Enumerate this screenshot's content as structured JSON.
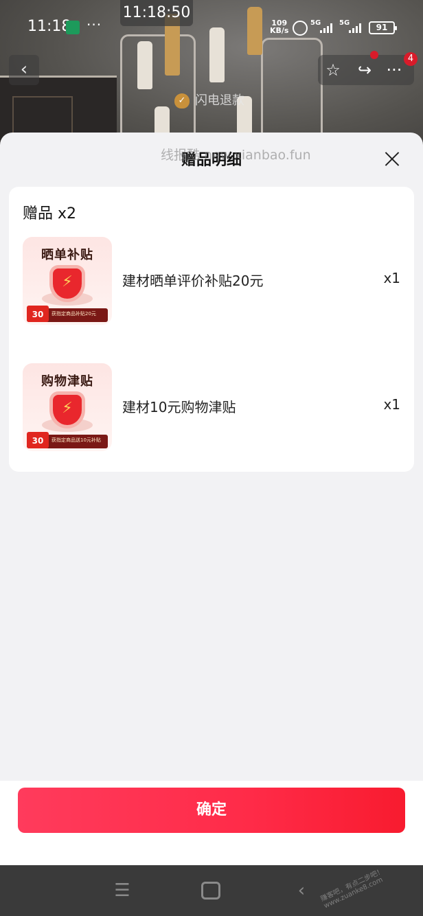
{
  "status_bar": {
    "time": "11:18",
    "screen_clock": "11:18:50",
    "more": "···",
    "net_speed_value": "109",
    "net_speed_unit": "KB/s",
    "signal_1": "5G",
    "signal_2": "5G",
    "battery": "91"
  },
  "nav": {
    "back_icon": "‹",
    "star_icon": "☆",
    "share_icon": "↪",
    "more_icon": "···",
    "more_badge": "4"
  },
  "banner": {
    "refund_label": "闪电退款"
  },
  "sheet": {
    "title": "赠品明细",
    "watermark": "线报酷 new.xianbao.fun",
    "gift_header": "赠品 x2",
    "gifts": [
      {
        "thumb_title": "晒单补贴",
        "thumb_tag": "30",
        "thumb_strip": "获指定商品补贴20元",
        "name": "建材晒单评价补贴20元",
        "qty": "x1"
      },
      {
        "thumb_title": "购物津贴",
        "thumb_tag": "30",
        "thumb_strip": "获指定商品送10元补贴",
        "name": "建材10元购物津贴",
        "qty": "x1"
      }
    ],
    "confirm_label": "确定"
  },
  "system_nav": {
    "menu_icon": "☰",
    "back_icon": "‹",
    "watermark": "赚客吧，有点二步吧！ www.zuanke8.com"
  },
  "colors": {
    "accent": "#ff2b48",
    "sheet_bg": "#f2f2f4",
    "badge_red": "#d81b2a"
  }
}
